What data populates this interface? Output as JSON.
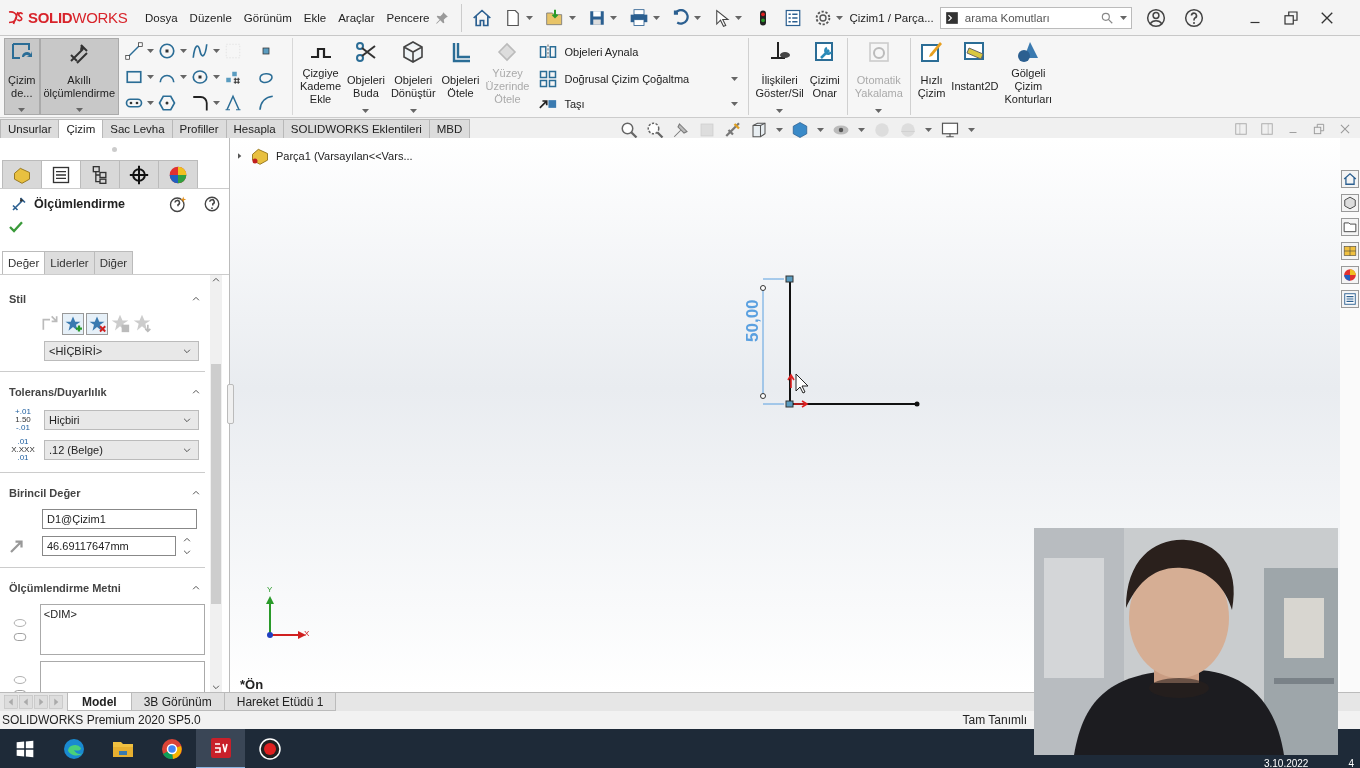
{
  "title_bar": {
    "logo": "**SOLID**WORKS",
    "menu": [
      "Dosya",
      "Düzenle",
      "Görünüm",
      "Ekle",
      "Araçlar",
      "Pencere"
    ],
    "document_title": "Çizim1 / Parça...",
    "search": {
      "placeholder": "arama Komutları"
    }
  },
  "ribbon": [
    {
      "kind": "large",
      "label": "Çizim\nde...",
      "selected": true,
      "disabled": false,
      "dropdown": true
    },
    {
      "kind": "large",
      "label": "Akıllı\nölçümlendirme",
      "selected": true,
      "disabled": false,
      "dropdown": true
    },
    {
      "kind": "grid"
    },
    {
      "kind": "large",
      "label": "Çizgiye\nKademe\nEkle",
      "selected": false,
      "disabled": false,
      "dropdown": false
    },
    {
      "kind": "large",
      "label": "Objeleri\nBuda",
      "selected": false,
      "disabled": false,
      "dropdown": true
    },
    {
      "kind": "large",
      "label": "Objeleri\nDönüştür",
      "selected": false,
      "disabled": false,
      "dropdown": true
    },
    {
      "kind": "large",
      "label": "Objeleri\nÖtele",
      "selected": false,
      "disabled": false,
      "dropdown": false
    },
    {
      "kind": "large",
      "label": "Yüzey\nÜzerinde\nÖtele",
      "selected": false,
      "disabled": true,
      "dropdown": false
    },
    {
      "kind": "list",
      "entries": [
        "Objeleri Aynala",
        "Doğrusal Çizim Çoğaltma",
        "Taşı"
      ]
    },
    {
      "kind": "separator"
    },
    {
      "kind": "large",
      "label": "İlişkileri\nGöster/Sil",
      "selected": false,
      "disabled": false,
      "dropdown": true
    },
    {
      "kind": "large",
      "label": "Çizimi\nOnar",
      "selected": false,
      "disabled": false,
      "dropdown": false
    },
    {
      "kind": "separator"
    },
    {
      "kind": "large",
      "label": "Otomatik\nYakalama",
      "selected": false,
      "disabled": true,
      "dropdown": true
    },
    {
      "kind": "separator"
    },
    {
      "kind": "large",
      "label": "Hızlı\nÇizim",
      "selected": false,
      "disabled": false,
      "dropdown": false
    },
    {
      "kind": "large",
      "label": "Instant2D",
      "selected": false,
      "disabled": false,
      "dropdown": false
    },
    {
      "kind": "large",
      "label": "Gölgeli\nÇizim\nKonturları",
      "selected": false,
      "disabled": false,
      "dropdown": false
    }
  ],
  "command_tabs": [
    {
      "label": "Unsurlar",
      "selected": false
    },
    {
      "label": "Çizim",
      "selected": true
    },
    {
      "label": "Sac Levha",
      "selected": false
    },
    {
      "label": "Profiller",
      "selected": false
    },
    {
      "label": "Hesapla",
      "selected": false
    },
    {
      "label": "SOLIDWORKS Eklentileri",
      "selected": false
    },
    {
      "label": "MBD",
      "selected": false
    }
  ],
  "property_manager": {
    "tabs": [
      {
        "selected": false
      },
      {
        "selected": true
      },
      {
        "selected": false
      },
      {
        "selected": false
      },
      {
        "selected": false
      }
    ],
    "title": "Ölçümlendirme",
    "subtabs": [
      {
        "label": "Değer",
        "selected": true
      },
      {
        "label": "Liderler",
        "selected": false
      },
      {
        "label": "Diğer",
        "selected": false
      }
    ],
    "sections": [
      {
        "kind": "style",
        "title": "Stil",
        "select": "<HİÇBİRİ>"
      },
      {
        "kind": "tolerance",
        "title": "Tolerans/Duyarlılık",
        "rows": [
          {
            "icon_text": [
              "+.01",
              "1.50",
              "-.01"
            ],
            "select": "Hiçbiri"
          },
          {
            "icon_text": [
              ".01",
              "X.XXX",
              ".01"
            ],
            "select": ".12 (Belge)"
          }
        ]
      },
      {
        "kind": "primary",
        "title": "Birincil Değer",
        "name": "D1@Çizim1",
        "value": "46.69117647mm"
      },
      {
        "kind": "text",
        "title": "Ölçümlendirme Metni",
        "value": "<DIM>"
      }
    ]
  },
  "viewport": {
    "tree_item": "Parça1  (Varsayılan<<Vars...",
    "dimension": "50,00",
    "axes": {
      "x": "X",
      "y": "Y"
    },
    "view_name": "*Ön"
  },
  "bottom_tabs": [
    {
      "label": "Model",
      "selected": true
    },
    {
      "label": "3B Görünüm",
      "selected": false
    },
    {
      "label": "Hareket Etüdü 1",
      "selected": false
    }
  ],
  "status_bar": {
    "product": "SOLIDWORKS Premium 2020 SP5.0",
    "sketch_state": "Tam Tanımlı"
  },
  "taskbar": {
    "apps": [
      {
        "selected": false
      },
      {
        "selected": false
      },
      {
        "selected": false
      },
      {
        "selected": true
      },
      {
        "selected": false
      }
    ],
    "date": "3.10.2022",
    "notification_count": "4"
  }
}
